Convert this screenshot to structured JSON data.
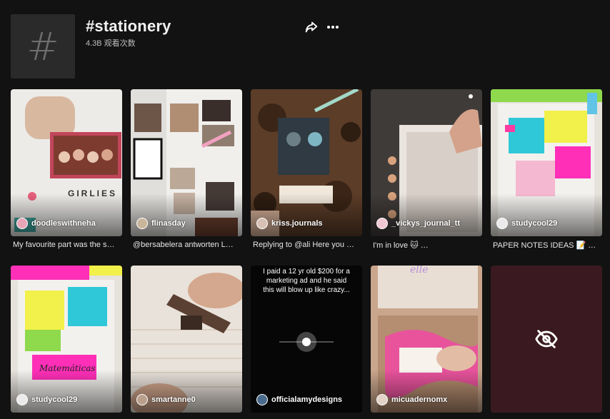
{
  "header": {
    "title": "#stationery",
    "views": "4.3B 观看次数",
    "hash_symbol": "#",
    "share_icon": "share-arrow-icon",
    "more_icon": "more-dots-icon"
  },
  "videos": [
    {
      "author": "doodleswithneha",
      "caption": "My favourite part was the s…"
    },
    {
      "author": "flinasday",
      "caption": "@bersabelera antworten L…"
    },
    {
      "author": "kriss.journals",
      "caption": "Replying to @ali Here you …"
    },
    {
      "author": "_vickys_journal_tt",
      "caption": "I'm in love 🐱 …"
    },
    {
      "author": "studycool29",
      "caption": "PAPER NOTES IDEAS 📝 …"
    },
    {
      "author": "studycool29",
      "caption": ""
    },
    {
      "author": "smartanne0",
      "caption": ""
    },
    {
      "author": "officialamydesigns",
      "caption": "",
      "overlay_text": "I paid a 12 yr old $200 for a marketing ad and he said this will blow up like crazy..."
    },
    {
      "author": "micuadernomx",
      "caption": ""
    },
    {
      "author": "",
      "caption": "",
      "hidden": true,
      "icon": "eye-off-icon"
    }
  ]
}
